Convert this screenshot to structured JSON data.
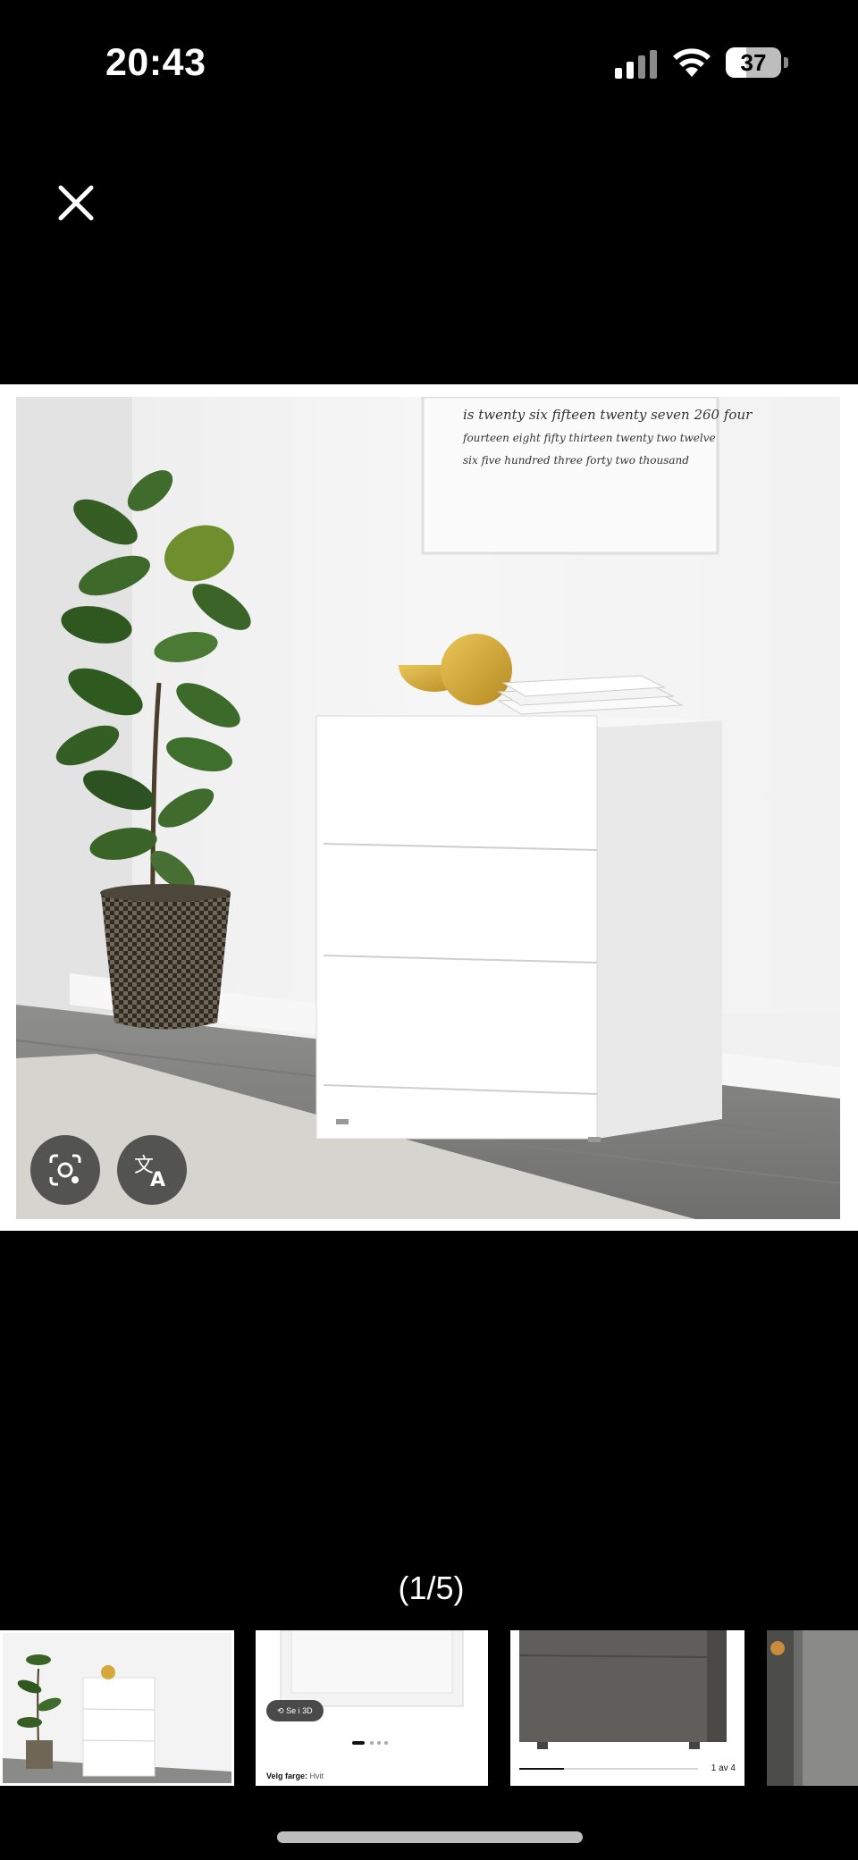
{
  "status_bar": {
    "time": "20:43",
    "battery_level": "37",
    "battery_fraction": 0.37,
    "icons": [
      "cellular-signal-icon",
      "wifi-icon",
      "battery-icon"
    ]
  },
  "viewer": {
    "close_icon": "close-icon",
    "counter": "(1/5)",
    "image_actions": [
      "lens-search-icon",
      "translate-icon"
    ],
    "artwork_text": [
      "is twenty six fifteen twenty seven 260 four",
      "fourteen eight fifty thirteen twenty two twelve",
      "six five hundred three forty two thousand"
    ]
  },
  "thumbnails": [
    {
      "name": "thumbnail-white-cabinet-room",
      "selected": true
    },
    {
      "name": "thumbnail-open-shelf",
      "view_3d_label": "Se i 3D",
      "color_label": "Velg farge:",
      "color_value": "Hvit"
    },
    {
      "name": "thumbnail-dark-grey-cabinet",
      "page_label": "1 av 4",
      "progress_fraction": 0.25
    },
    {
      "name": "thumbnail-partial"
    }
  ],
  "colors": {
    "background": "#000000",
    "cabinet": "#ffffff",
    "dark_cabinet": "#5f5e5b",
    "home_indicator": "#bdbdbd"
  }
}
